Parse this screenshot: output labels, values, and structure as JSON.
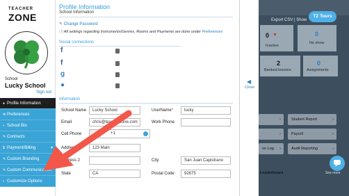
{
  "sidebar": {
    "logo_top": "TEACHER",
    "logo_bottom": "ZONE",
    "school_caption": "School",
    "school_name": "Lucky School",
    "sign_out": "Sign out",
    "menu": [
      {
        "label": "Profile Information",
        "icon": "info-icon",
        "active": true
      },
      {
        "label": "Preferences",
        "icon": "gears-icon"
      },
      {
        "label": "School Bio",
        "icon": "bio-icon"
      },
      {
        "label": "Contracts",
        "icon": "contract-icon"
      },
      {
        "label": "Payment/Billing",
        "icon": "dollar-icon",
        "chevron": "▾"
      },
      {
        "label": "Custom Branding",
        "icon": "brush-icon"
      },
      {
        "label": "Custom Communication",
        "icon": "pencil-icon"
      },
      {
        "label": "Customize Options",
        "icon": "options-icon"
      }
    ]
  },
  "panel": {
    "title": "Profile Information",
    "subtitle": "School Information",
    "change_password": "Change Password",
    "notice": "All settings regarding Instruments/Genres, Rooms and Payments are done under",
    "notice_link": "Preferences",
    "social_title": "Social connections",
    "social_icons": [
      "facebook-icon",
      "facebook-icon",
      "google-icon",
      "apple-icon"
    ],
    "info_title": "Information",
    "fields": {
      "school_name_label": "School Name",
      "school_name_value": "Lucky School",
      "username_label": "UserName",
      "username_required": "*",
      "username_value": "lucky",
      "email_label": "Email",
      "email_value": "chris@teacherzone.com",
      "work_phone_label": "Work Phone",
      "work_phone_value": "",
      "cell_phone_label": "Cell Phone",
      "cell_phone_code": "+1",
      "address_label": "Address",
      "address_value": "123 Main",
      "address2_label": "Address 2",
      "address2_value": "",
      "city_label": "City",
      "city_value": "San Juan Capistrano",
      "state_label": "State",
      "state_value": "CA",
      "postal_label": "Postal Code",
      "postal_value": "92675"
    }
  },
  "close": {
    "chevron": "◀",
    "label": "Close"
  },
  "dashboard": {
    "export": "Export CSV | Show",
    "tz_tours": "TZ Tours",
    "stats": [
      {
        "number": "0",
        "label": "Inactive",
        "arrow": "▼"
      },
      {
        "number": "0",
        "label": "No show"
      },
      {
        "number": "2",
        "label": "Banked lessons"
      },
      {
        "number": "0",
        "label": "Assignments"
      }
    ],
    "reports": [
      "Student Report",
      "Payroll",
      "Audit Reporting",
      "on Log"
    ],
    "leaderboard": "Leaderboard",
    "see_more": "See more"
  },
  "colors": {
    "accent": "#3aa4d6",
    "arrow": "#f2574a",
    "active_menu": "#1e1e1e"
  }
}
